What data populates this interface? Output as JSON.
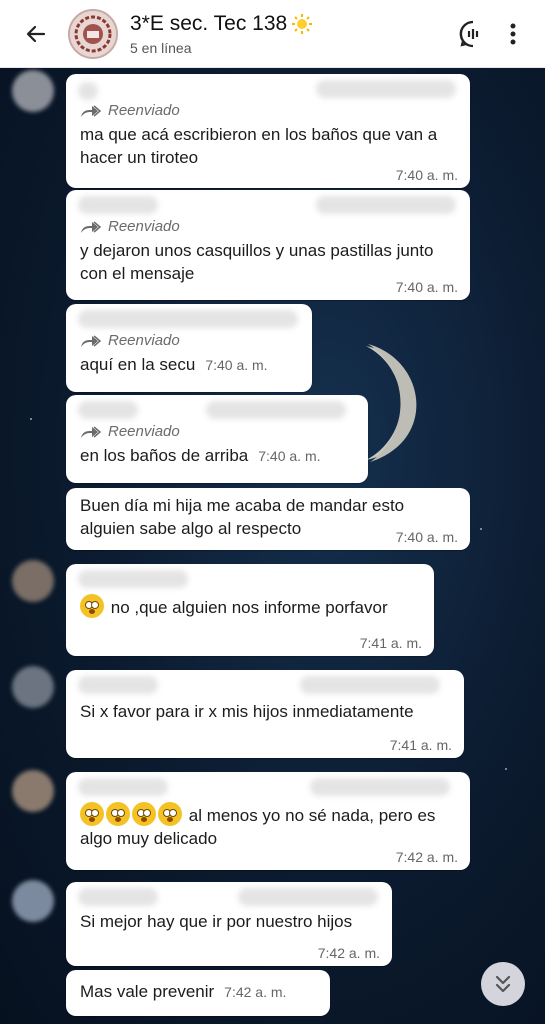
{
  "header": {
    "title": "3*E sec. Tec 138",
    "title_emoji": "sun-emoji",
    "subtitle": "5 en línea"
  },
  "forwarded_label": "Reenviado",
  "messages": [
    {
      "text": "ma que acá escribieron en los baños que van a hacer un tiroteo",
      "time": "7:40 a. m.",
      "forwarded": true
    },
    {
      "text": "y dejaron unos casquillos y unas pastillas junto con el mensaje",
      "time": "7:40 a. m.",
      "forwarded": true
    },
    {
      "text": "aquí en la secu",
      "time": "7:40 a. m.",
      "forwarded": true
    },
    {
      "text": "en los baños de arriba",
      "time": "7:40 a. m.",
      "forwarded": true
    },
    {
      "text": "Buen día mi hija me acaba de mandar esto alguien sabe algo al respecto",
      "time": "7:40 a. m.",
      "forwarded": false
    },
    {
      "text": "no ,que alguien nos informe porfavor",
      "time": "7:41 a. m.",
      "emoji_count": 1
    },
    {
      "text": "Si x favor para ir x mis hijos inmediatamente",
      "time": "7:41 a. m."
    },
    {
      "text": "al menos yo no sé nada, pero es algo muy delicado",
      "time": "7:42 a. m.",
      "emoji_count": 4
    },
    {
      "text": "Si mejor hay que ir por nuestro hijos",
      "time": "7:42 a. m."
    },
    {
      "text": "Mas vale prevenir",
      "time": "7:42 a. m."
    }
  ],
  "colors": {
    "bubble": "#ffffff",
    "background": "#0b1a2e",
    "header": "#ffffff",
    "emoji": "#f5c226"
  }
}
